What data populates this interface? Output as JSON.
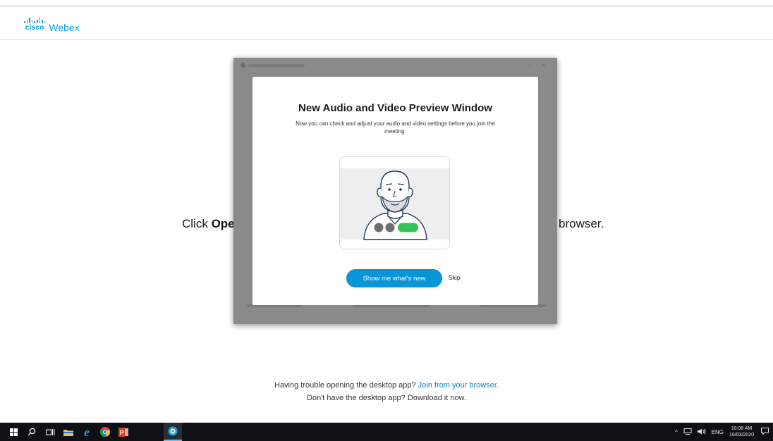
{
  "brand": {
    "company": "cisco",
    "product": "Webex",
    "color": "#049fd9"
  },
  "background": {
    "left_prefix": "Click ",
    "left_bold": "Ope",
    "right_text": "browser.",
    "trouble_text": "Having trouble opening the desktop app? ",
    "trouble_link": "Join from your browser.",
    "download_text": "Don't have the desktop app? Download it now."
  },
  "dialog": {
    "title": "New Audio and Video Preview Window",
    "description": "Now you can check and adjust your audio and video settings before you join the meeting.",
    "primary_button": "Show me what's new",
    "skip_label": "Skip",
    "accent": "#0896d8"
  },
  "taskbar": {
    "icons": [
      "windows-start-icon",
      "search-icon",
      "task-view-icon",
      "file-explorer-icon",
      "edge-icon",
      "chrome-icon",
      "powerpoint-icon",
      "webex-icon"
    ],
    "tray": {
      "language": "ENG",
      "time": "10:08 AM",
      "date": "16/03/2020"
    }
  }
}
